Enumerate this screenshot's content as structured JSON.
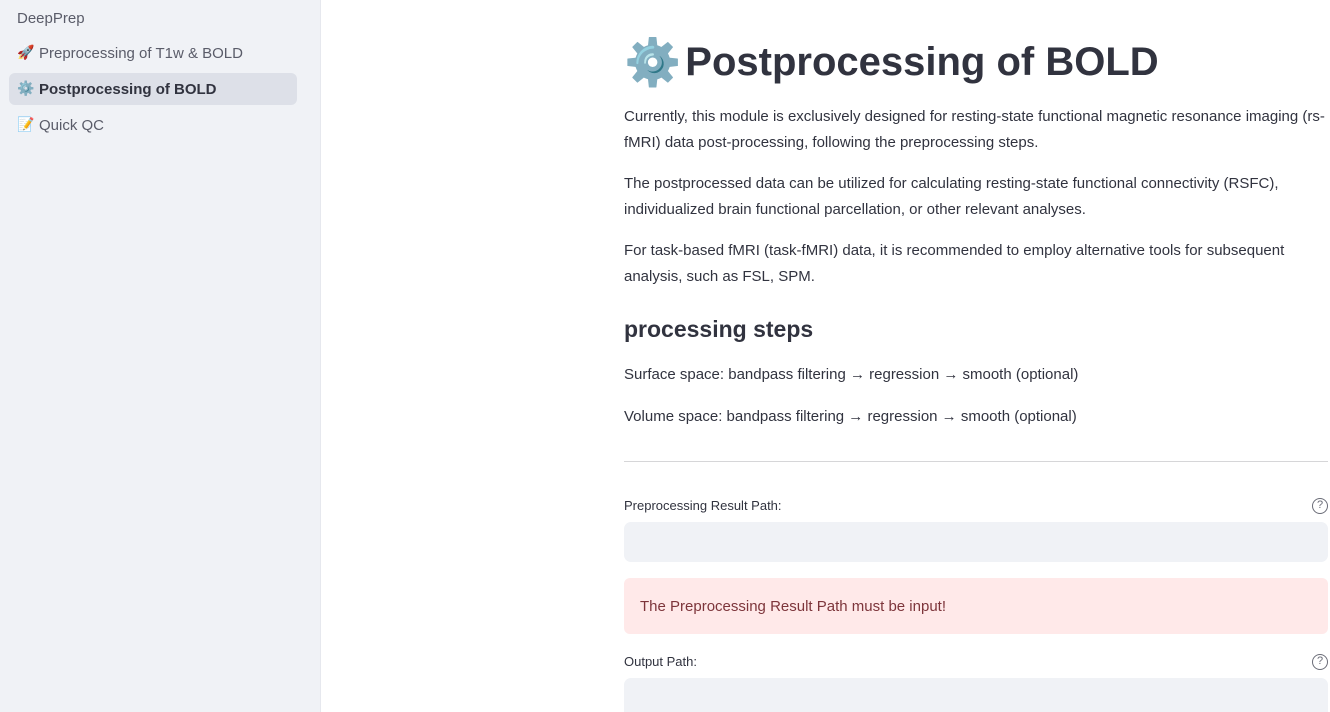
{
  "sidebar": {
    "app_name": "DeepPrep",
    "items": [
      {
        "emoji": "🚀",
        "label": "Preprocessing of T1w & BOLD"
      },
      {
        "emoji": "⚙️",
        "label": "Postprocessing of BOLD"
      },
      {
        "emoji": "📝",
        "label": "Quick QC"
      }
    ],
    "active_index": 1
  },
  "main": {
    "title_emoji": "⚙️",
    "title": "Postprocessing of BOLD",
    "paragraphs": [
      "Currently, this module is exclusively designed for resting-state functional magnetic resonance imaging (rs-fMRI) data post-processing, following the preprocessing steps.",
      "The postprocessed data can be utilized for calculating resting-state functional connectivity (RSFC), individualized brain functional parcellation, or other relevant analyses.",
      "For task-based fMRI (task-fMRI) data, it is recommended to employ alternative tools for subsequent analysis, such as FSL, SPM."
    ],
    "steps_heading": "processing steps",
    "steps": [
      "Surface space: bandpass filtering → regression → smooth (optional)",
      "Volume space: bandpass filtering → regression → smooth (optional)"
    ],
    "preprocessing_path": {
      "label": "Preprocessing Result Path:",
      "value": "",
      "help": "?"
    },
    "error_message": "The Preprocessing Result Path must be input!",
    "output_path": {
      "label": "Output Path:",
      "value": "",
      "help": "?"
    }
  },
  "colors": {
    "sidebar_bg": "#f0f2f6",
    "active_item_bg": "#dde0e8",
    "input_bg": "#f0f2f6",
    "error_bg": "#ffe9e9",
    "error_text": "#7d353b"
  }
}
